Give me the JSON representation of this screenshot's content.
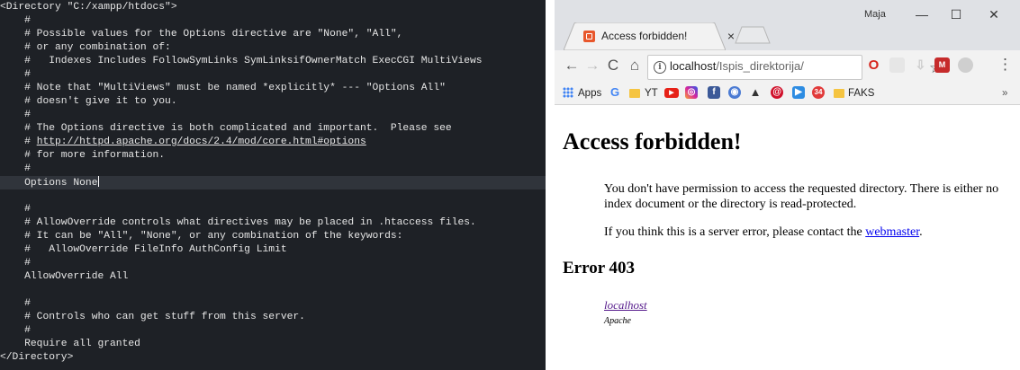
{
  "editor": {
    "lines": [
      "<Directory \"C:/xampp/htdocs\">",
      "    #",
      "    # Possible values for the Options directive are \"None\", \"All\",",
      "    # or any combination of:",
      "    #   Indexes Includes FollowSymLinks SymLinksifOwnerMatch ExecCGI MultiViews",
      "    #",
      "    # Note that \"MultiViews\" must be named *explicitly* --- \"Options All\"",
      "    # doesn't give it to you.",
      "    #",
      "    # The Options directive is both complicated and important.  Please see",
      "    # http://httpd.apache.org/docs/2.4/mod/core.html#options",
      "    # for more information.",
      "    #",
      "    Options None",
      "",
      "    #",
      "    # AllowOverride controls what directives may be placed in .htaccess files.",
      "    # It can be \"All\", \"None\", or any combination of the keywords:",
      "    #   AllowOverride FileInfo AuthConfig Limit",
      "    #",
      "    AllowOverride All",
      "",
      "    #",
      "    # Controls who can get stuff from this server.",
      "    #",
      "    Require all granted",
      "</Directory>"
    ],
    "link_line": {
      "prefix": "    # ",
      "url": "http://httpd.apache.org/docs/2.4/mod/core.html#options"
    },
    "current_line": "    Options None"
  },
  "browser": {
    "tab_title": "Access forbidden!",
    "tab_close": "×",
    "user_name": "Maja",
    "window_controls": {
      "minimize": "—",
      "maximize": "☐",
      "close": "✕"
    },
    "nav": {
      "back": "←",
      "forward": "→",
      "reload": "C",
      "home": "⌂"
    },
    "address": {
      "host": "localhost",
      "path": "/Ispis_direktorija/"
    },
    "star": "☆",
    "menu": "⋮",
    "extensions": {
      "opera": "O",
      "m": "M"
    },
    "bookmarks": {
      "apps": "Apps",
      "g": "G",
      "yt": "YT",
      "faks": "FAKS",
      "badge": "34",
      "more": "»"
    },
    "page": {
      "heading": "Access forbidden!",
      "paragraph1": "You don't have permission to access the requested directory. There is either no index document or the directory is read-protected.",
      "paragraph2_text": "If you think this is a server error, please contact the ",
      "paragraph2_link": "webmaster",
      "paragraph2_end": ".",
      "error_heading": "Error 403",
      "address_host": "localhost",
      "address_server": "Apache"
    }
  }
}
